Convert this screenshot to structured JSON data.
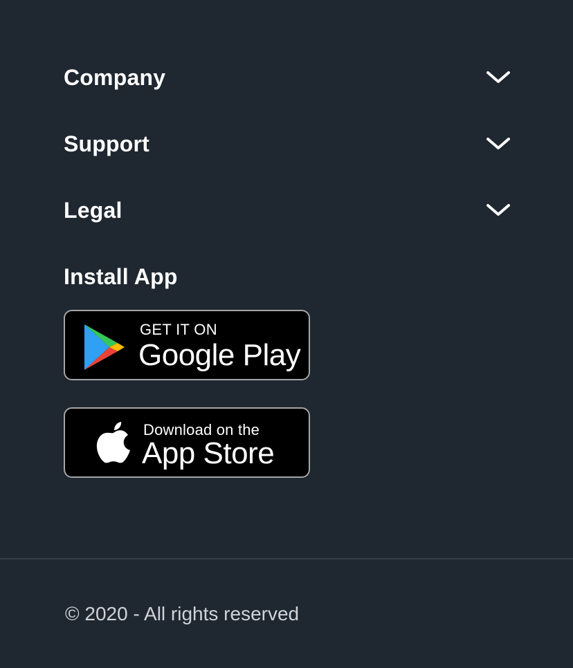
{
  "accordion": [
    {
      "label": "Company",
      "icon": "chevron-down-icon"
    },
    {
      "label": "Support",
      "icon": "chevron-down-icon"
    },
    {
      "label": "Legal",
      "icon": "chevron-down-icon"
    }
  ],
  "install": {
    "heading": "Install App",
    "google_play": {
      "small_text": "GET IT ON",
      "big_text": "Google Play",
      "icon": "google-play-icon"
    },
    "app_store": {
      "small_text": "Download on the",
      "big_text": "App Store",
      "icon": "apple-icon"
    }
  },
  "footer": {
    "copyright": "© 2020 - All rights reserved"
  },
  "colors": {
    "background": "#1f2730",
    "text": "#ffffff",
    "muted_text": "#d0d4d9",
    "badge_background": "#000000",
    "badge_border": "#a6a6a6",
    "divider": "#353e48"
  }
}
